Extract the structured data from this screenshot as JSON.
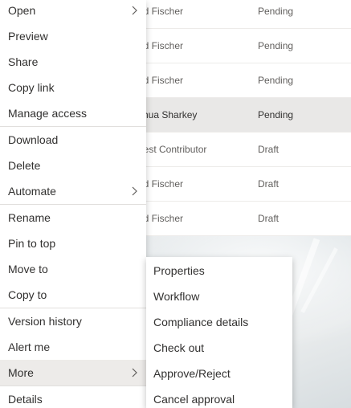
{
  "list": {
    "rows": [
      {
        "author": "ad Fischer",
        "status": "Pending",
        "selected": false
      },
      {
        "author": "ad Fischer",
        "status": "Pending",
        "selected": false
      },
      {
        "author": "ad Fischer",
        "status": "Pending",
        "selected": false
      },
      {
        "author": "shua Sharkey",
        "status": "Pending",
        "selected": true
      },
      {
        "author": "uest Contributor",
        "status": "Draft",
        "selected": false
      },
      {
        "author": "ad Fischer",
        "status": "Draft",
        "selected": false
      },
      {
        "author": "ad Fischer",
        "status": "Draft",
        "selected": false
      }
    ]
  },
  "menu": {
    "items": [
      {
        "label": "Open",
        "submenu": true
      },
      {
        "label": "Preview"
      },
      {
        "label": "Share"
      },
      {
        "label": "Copy link"
      },
      {
        "label": "Manage access"
      },
      {
        "label": "Download"
      },
      {
        "label": "Delete"
      },
      {
        "label": "Automate",
        "submenu": true
      },
      {
        "label": "Rename"
      },
      {
        "label": "Pin to top"
      },
      {
        "label": "Move to"
      },
      {
        "label": "Copy to"
      },
      {
        "label": "Version history"
      },
      {
        "label": "Alert me"
      },
      {
        "label": "More",
        "submenu": true,
        "active": true
      },
      {
        "label": "Details"
      }
    ]
  },
  "submenu": {
    "items": [
      {
        "label": "Properties"
      },
      {
        "label": "Workflow"
      },
      {
        "label": "Compliance details"
      },
      {
        "label": "Check out"
      },
      {
        "label": "Approve/Reject"
      },
      {
        "label": "Cancel approval"
      }
    ]
  },
  "icons": {
    "chevron": "chevron-right-icon"
  }
}
